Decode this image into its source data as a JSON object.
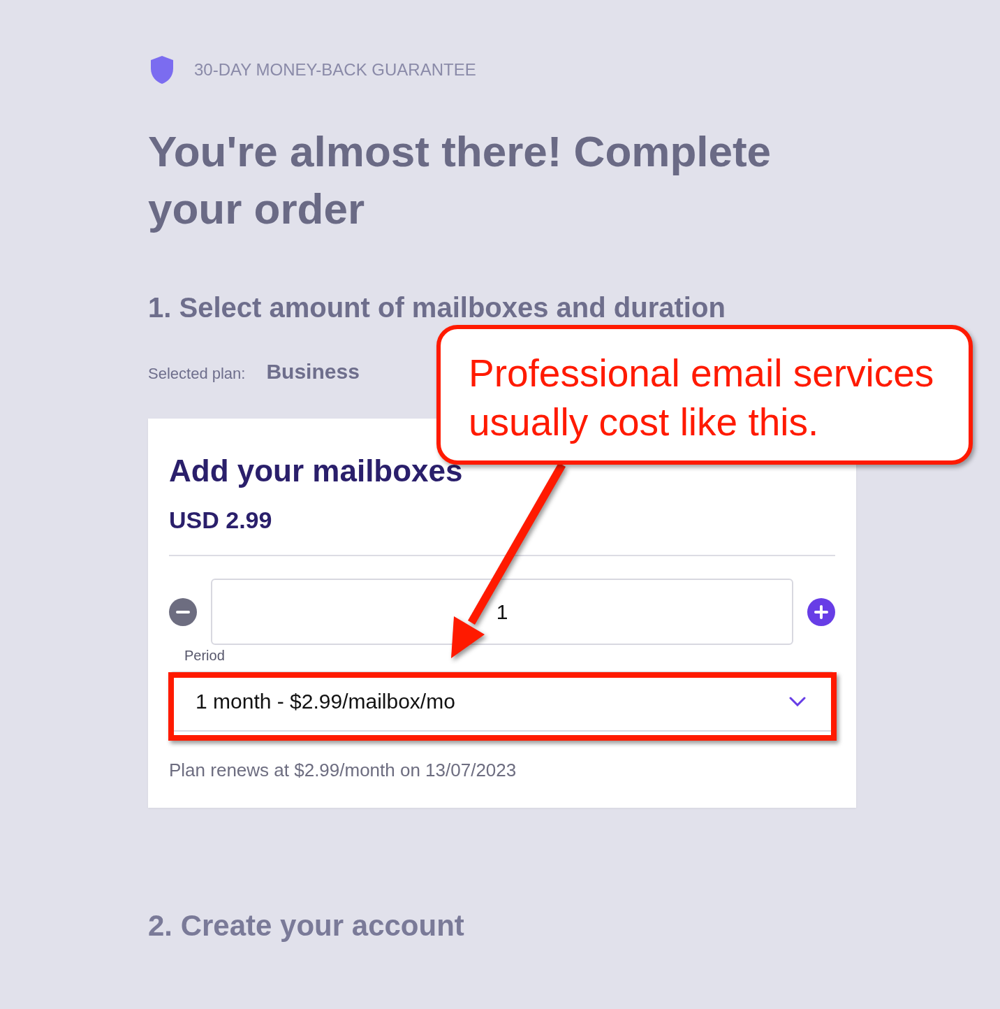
{
  "guarantee": {
    "text": "30-DAY MONEY-BACK GUARANTEE"
  },
  "heading": "You're almost there! Complete your order",
  "step_1": {
    "title": "1. Select amount of mailboxes and duration",
    "plan_label": "Selected plan:",
    "plan_value": "Business"
  },
  "card": {
    "title": "Add your mailboxes",
    "price": "USD 2.99",
    "quantity": "1",
    "period": {
      "label": "Period",
      "value": "1 month - $2.99/mailbox/mo"
    },
    "renewal_note": "Plan renews at $2.99/month on 13/07/2023"
  },
  "step_2": {
    "title": "2. Create your account"
  },
  "annotation": {
    "callout": "Professional email services usually cost like this."
  }
}
